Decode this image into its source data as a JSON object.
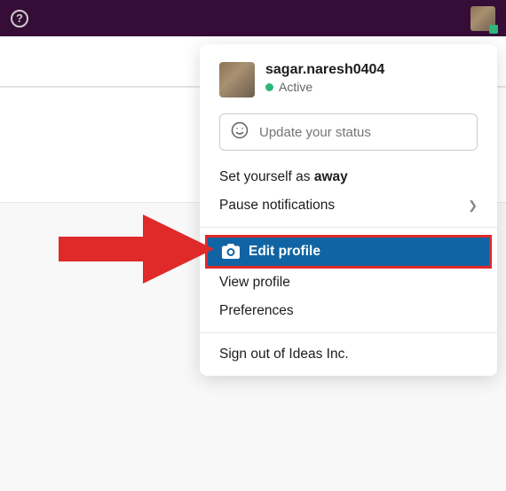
{
  "user": {
    "name": "sagar.naresh0404",
    "status_text": "Active"
  },
  "status_placeholder": "Update your status",
  "menu": {
    "away_prefix": "Set yourself as ",
    "away_bold": "away",
    "pause": "Pause notifications",
    "edit_profile": "Edit profile",
    "view_profile": "View profile",
    "preferences": "Preferences",
    "signout": "Sign out of Ideas Inc."
  }
}
